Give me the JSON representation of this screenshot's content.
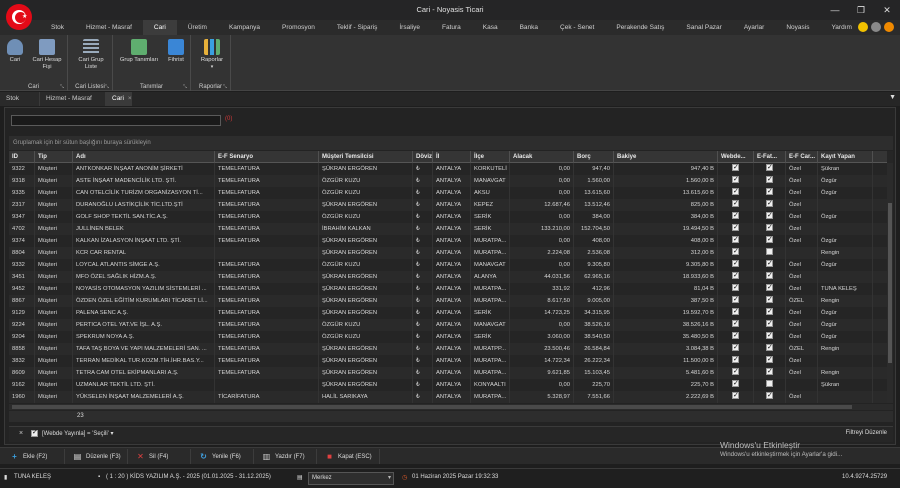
{
  "window": {
    "title": "Cari - Noyasis Ticari"
  },
  "menu": [
    "Stok",
    "Hizmet - Masraf",
    "Cari",
    "Üretim",
    "Kampanya",
    "Promosyon",
    "Teklif - Sipariş",
    "İrsaliye",
    "Fatura",
    "Kasa",
    "Banka",
    "Çek - Senet",
    "Perakende Satış",
    "Sanal Pazar",
    "Ayarlar",
    "Noyasis",
    "Yardım"
  ],
  "menu_active": "Cari",
  "ribbon": {
    "groups": [
      {
        "label": "Cari",
        "buttons": [
          "Cari",
          "Cari Hesap Fişi"
        ]
      },
      {
        "label": "Cari Listesi",
        "buttons": [
          "Cari Grup Liste"
        ]
      },
      {
        "label": "Tanımlar",
        "buttons": [
          "Grup Tanımları",
          "Fihrist"
        ]
      },
      {
        "label": "Raporlar",
        "buttons": [
          "Raporlar"
        ]
      }
    ]
  },
  "doc_tabs": [
    {
      "label": "Stok"
    },
    {
      "label": "Hizmet - Masraf"
    },
    {
      "label": "Cari"
    }
  ],
  "search": {
    "value": "",
    "hint": "(0)"
  },
  "group_panel_text": "Gruplamak için bir sütun başlığını buraya sürükleyin",
  "grid": {
    "columns": [
      "ID",
      "Tip",
      "Adı",
      "E-F Senaryo",
      "Müşteri Temsilcisi",
      "Döviz",
      "İl",
      "İlçe",
      "Alacak",
      "Borç",
      "Bakiye",
      "Webde...",
      "E-Fat...",
      "E-F Car...",
      "Kayıt Yapan"
    ],
    "rows": [
      [
        "9322",
        "Müşteri",
        "ANTKONKAR İNŞAAT ANONİM ŞİRKETİ",
        "TEMELFATURA",
        "ŞÜKRAN ERGÖREN",
        "₺",
        "ANTALYA",
        "KORKUTELİ",
        "0,00",
        "947,40",
        "947,40 B",
        true,
        true,
        "Özel",
        "Şükran"
      ],
      [
        "9318",
        "Müşteri",
        "ASTE İNŞAAT MADENCİLİK LTD. ŞTİ.",
        "TEMELFATURA",
        "ÖZGÜR KUZU",
        "₺",
        "ANTALYA",
        "MANAVGAT",
        "0,00",
        "1.560,00",
        "1.560,00 B",
        true,
        true,
        "Özel",
        "Özgür"
      ],
      [
        "9335",
        "Müşteri",
        "CAN OTELCİLİK TURİZM ORGANİZASYON Tİ...",
        "TEMELFATURA",
        "ÖZGÜR KUZU",
        "₺",
        "ANTALYA",
        "AKSU",
        "0,00",
        "13.615,60",
        "13.615,60 B",
        true,
        true,
        "Özel",
        "Özgür"
      ],
      [
        "2317",
        "Müşteri",
        "DURANOĞLU LASTİKÇİLİK TİC.LTD.ŞTİ",
        "TEMELFATURA",
        "ŞÜKRAN ERGÖREN",
        "₺",
        "ANTALYA",
        "KEPEZ",
        "12.687,46",
        "13.512,46",
        "825,00 B",
        true,
        true,
        "Özel",
        ""
      ],
      [
        "9347",
        "Müşteri",
        "GOLF SHOP TEKTİL SAN.TİC.A.Ş.",
        "TEMELFATURA",
        "ÖZGÜR KUZU",
        "₺",
        "ANTALYA",
        "SERİK",
        "0,00",
        "384,00",
        "384,00 B",
        true,
        true,
        "Özel",
        "Özgür"
      ],
      [
        "4702",
        "Müşteri",
        "JULLİNEN BELEK",
        "TEMELFATURA",
        "İBRAHİM KALKAN",
        "₺",
        "ANTALYA",
        "SERİK",
        "133.210,00",
        "152.704,50",
        "19.494,50 B",
        true,
        true,
        "Özel",
        ""
      ],
      [
        "9374",
        "Müşteri",
        "KALKAN İZALASYON İNŞAAT LTD. ŞTİ.",
        "TEMELFATURA",
        "ŞÜKRAN ERGÖREN",
        "₺",
        "ANTALYA",
        "MURATPA...",
        "0,00",
        "408,00",
        "408,00 B",
        true,
        true,
        "Özel",
        "Özgür"
      ],
      [
        "8804",
        "Müşteri",
        "KCR CAR RENTAL",
        "",
        "ŞÜKRAN ERGÖREN",
        "₺",
        "ANTALYA",
        "MURATPA...",
        "2.224,08",
        "2.536,08",
        "312,00 B",
        true,
        false,
        "",
        "Rengin"
      ],
      [
        "9332",
        "Müşteri",
        "LOYCAL ATLANTIS SİMGE A.Ş.",
        "TEMELFATURA",
        "ÖZGÜR KUZU",
        "₺",
        "ANTALYA",
        "MANAVGAT",
        "0,00",
        "9.305,80",
        "9.305,80 B",
        true,
        true,
        "Özel",
        "Özgür"
      ],
      [
        "3451",
        "Müşteri",
        "MFO ÖZEL SAĞLIK HİZM.A.Ş.",
        "TEMELFATURA",
        "ŞÜKRAN ERGÖREN",
        "₺",
        "ANTALYA",
        "ALANYA",
        "44.031,56",
        "62.965,16",
        "18.933,60 B",
        true,
        true,
        "Özel",
        ""
      ],
      [
        "9452",
        "Müşteri",
        "NOYASİS OTOMASYON YAZILIM SİSTEMLERİ ...",
        "TEMELFATURA",
        "ŞÜKRAN ERGÖREN",
        "₺",
        "ANTALYA",
        "MURATPA...",
        "331,92",
        "412,96",
        "81,04 B",
        true,
        true,
        "Özel",
        "TUNA KELEŞ"
      ],
      [
        "8867",
        "Müşteri",
        "ÖZDEN ÖZEL EĞİTİM KURUMLARI TİCARET Lİ...",
        "TEMELFATURA",
        "ŞÜKRAN ERGÖREN",
        "₺",
        "ANTALYA",
        "MURATPA...",
        "8.617,50",
        "9.005,00",
        "387,50 B",
        true,
        true,
        "ÖZEL",
        "Rengin"
      ],
      [
        "9129",
        "Müşteri",
        "PALENA SENC A.Ş.",
        "TEMELFATURA",
        "ŞÜKRAN ERGÖREN",
        "₺",
        "ANTALYA",
        "SERİK",
        "14.723,25",
        "34.315,95",
        "19.592,70 B",
        true,
        true,
        "Özel",
        "Özgür"
      ],
      [
        "9224",
        "Müşteri",
        "PERTICA OTEL YAT.VE İŞL. A.Ş.",
        "TEMELFATURA",
        "ÖZGÜR KUZU",
        "₺",
        "ANTALYA",
        "MANAVGAT",
        "0,00",
        "38.526,16",
        "38.526,16 B",
        true,
        true,
        "Özel",
        "Özgür"
      ],
      [
        "9204",
        "Müşteri",
        "SPEKRUM NOYA A.Ş.",
        "TEMELFATURA",
        "ÖZGÜR KUZU",
        "₺",
        "ANTALYA",
        "SERİK",
        "3.060,00",
        "38.540,50",
        "35.480,50 B",
        true,
        true,
        "Özel",
        "Özgür"
      ],
      [
        "8858",
        "Müşteri",
        "TAFA TAŞ BOYA VE YAPI MALZEMELERİ SAN. ...",
        "TEMELFATURA",
        "ŞÜKRAN ERGÖREN",
        "₺",
        "ANTALYA",
        "MURATPP...",
        "23.500,46",
        "26.584,84",
        "3.084,38 B",
        true,
        true,
        "ÖZEL",
        "Rengin"
      ],
      [
        "3832",
        "Müşteri",
        "TERRAN MEDİKAL TUR.KOZM.TİH.İHR.BAS.Y...",
        "TEMELFATURA",
        "ŞÜKRAN ERGÖREN",
        "₺",
        "ANTALYA",
        "MURATPA...",
        "14.722,34",
        "26.222,34",
        "11.500,00 B",
        true,
        true,
        "Özel",
        ""
      ],
      [
        "8609",
        "Müşteri",
        "TETRA CAM OTEL EKİPMANLARI A.Ş.",
        "TEMELFATURA",
        "ŞÜKRAN ERGÖREN",
        "₺",
        "ANTALYA",
        "MURATPA...",
        "9.621,85",
        "15.103,45",
        "5.481,60 B",
        true,
        true,
        "Özel",
        "Rengin"
      ],
      [
        "9162",
        "Müşteri",
        "UZMANLAR TEKTİL LTD. ŞTİ.",
        "",
        "ŞÜKRAN ERGÖREN",
        "₺",
        "ANTALYA",
        "KONYAALTI",
        "0,00",
        "225,70",
        "225,70 B",
        true,
        false,
        "",
        "Şükran"
      ],
      [
        "1960",
        "Müşteri",
        "YÜKSELEN İNŞAAT MALZEMELERİ A.Ş.",
        "TİCARİFATURA",
        "HALİL SARIKAYA",
        "₺",
        "ANTALYA",
        "MURATPA...",
        "5.328,97",
        "7.551,66",
        "2.222,69 B",
        true,
        true,
        "Özel",
        ""
      ]
    ],
    "footer_count": "23"
  },
  "filter": {
    "text": "[Webde Yayınla] = 'Seçili'",
    "edit_label": "Filtreyi Düzenle"
  },
  "actions": [
    {
      "label": "Ekle (F2)",
      "icon": "plus-icon",
      "color": "#3aa0e0"
    },
    {
      "label": "Düzenle (F3)",
      "icon": "edit-icon",
      "color": "#e0e0e0"
    },
    {
      "label": "Sil (F4)",
      "icon": "delete-icon",
      "color": "#e04040"
    },
    {
      "label": "Yenile (F6)",
      "icon": "refresh-icon",
      "color": "#40a0e0"
    },
    {
      "label": "Yazdır (F7)",
      "icon": "print-icon",
      "color": "#cccccc"
    },
    {
      "label": "Kapat (ESC)",
      "icon": "close-icon",
      "color": "#e04040"
    }
  ],
  "watermark": {
    "line1": "Windows'u Etkinleştir",
    "line2": "Windows'u etkinleştirmek için Ayarlar'a gidi..."
  },
  "status": {
    "user": "TUNA KELEŞ",
    "company": "( 1 : 20 )  KİDS YAZILIM A.Ş. - 2025  (01.01.2025 - 31.12.2025)",
    "branch": "Merkez",
    "datetime": "01 Haziran 2025 Pazar 19:32:33",
    "version": "10.4.9274.25729"
  }
}
